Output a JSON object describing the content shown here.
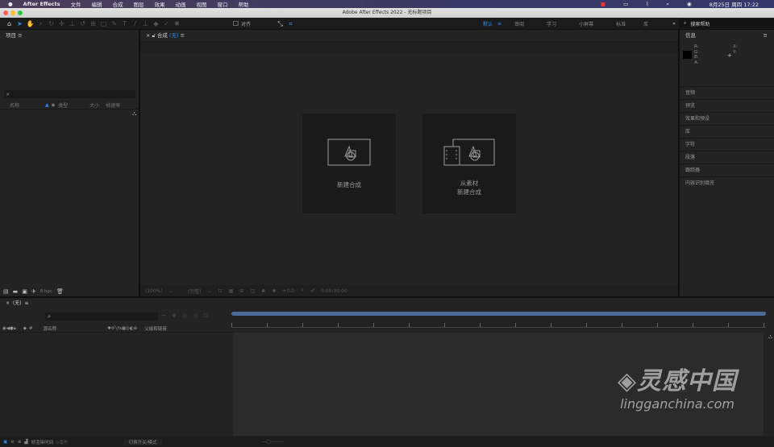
{
  "menubar": {
    "apple": "",
    "app": "After Effects",
    "items": [
      "文件",
      "编辑",
      "合成",
      "图层",
      "效果",
      "动画",
      "视图",
      "窗口",
      "帮助"
    ],
    "clock": "8月25日 周四  17:22"
  },
  "title": "Adobe After Effects 2022 - 无标题项目",
  "toolbar": {
    "snap_label": "对齐",
    "workspaces": [
      "默认",
      "审阅",
      "学习",
      "小屏幕",
      "标准",
      "库"
    ],
    "active_workspace": "默认",
    "search_placeholder": "搜索帮助",
    "accent": "#2d8ceb"
  },
  "project": {
    "title": "项目",
    "columns": [
      "名称",
      "类型",
      "大小",
      "帧速率"
    ],
    "bpc": "8 bpc"
  },
  "composition": {
    "tab_label": "合成",
    "tab_value": "(无)",
    "cards": [
      {
        "label": "新建合成"
      },
      {
        "label": "从素材",
        "label2": "新建合成"
      }
    ],
    "zoom": "(100%)",
    "quality": "(完整)",
    "exposure": "+0.0",
    "timecode": "0:00:00:00"
  },
  "info": {
    "title": "信息",
    "rgba": [
      "R:",
      "G:",
      "B:",
      "A:"
    ],
    "xy": [
      "X:",
      "Y:"
    ],
    "panels": [
      "音频",
      "预览",
      "效果和预设",
      "库",
      "字符",
      "段落",
      "跟踪器",
      "内容识别填充"
    ]
  },
  "timeline": {
    "tab": "(无)",
    "columns": {
      "source": "源名称",
      "parent": "父级和链接"
    },
    "footer": {
      "render_time": "帧渲染时间",
      "render_value": "0毫秒",
      "toggle": "切换开关/模式"
    }
  },
  "watermark": {
    "text": "灵感中国",
    "url": "lingganchina.com"
  }
}
